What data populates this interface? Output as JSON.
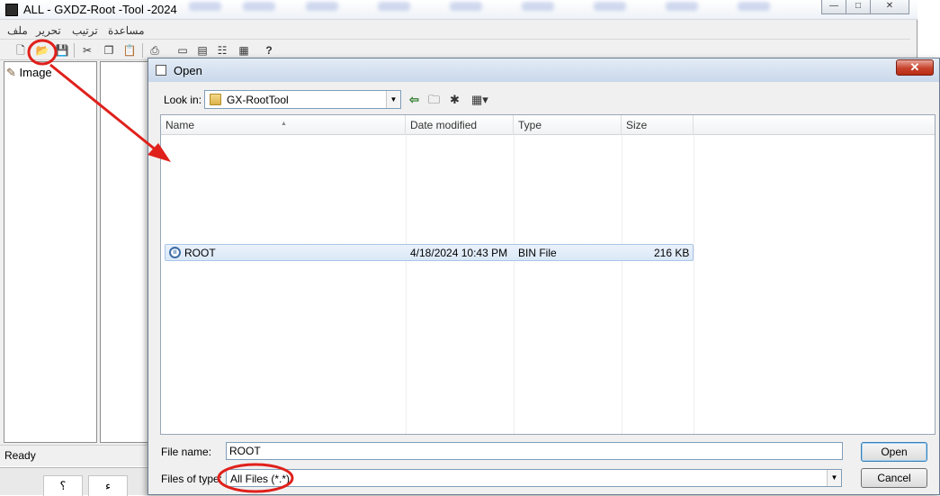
{
  "main_window": {
    "title": "ALL - GXDZ-Root -Tool -2024",
    "controls": {
      "minimize": "—",
      "maximize": "□",
      "close": "✕"
    },
    "menu": [
      "ملف",
      "تحرير",
      "ترتيب",
      "مساعدة"
    ],
    "tree_item": "Image",
    "status": "Ready"
  },
  "taskbar": {
    "keys": [
      "؟",
      "ء"
    ]
  },
  "dialog": {
    "title": "Open",
    "close_label": "✕",
    "look_in_label": "Look in:",
    "look_in_value": "GX-RootTool",
    "columns": [
      "Name",
      "Date modified",
      "Type",
      "Size"
    ],
    "files": [
      {
        "name": "ROOT",
        "date_modified": "4/18/2024 10:43 PM",
        "type": "BIN File",
        "size": "216 KB"
      }
    ],
    "file_name_label": "File name:",
    "file_name_value": "ROOT",
    "files_of_type_label": "Files of type:",
    "files_of_type_value": "All Files (*.*)",
    "open_button": "Open",
    "cancel_button": "Cancel"
  },
  "colors": {
    "annotation": "#e0201b",
    "selection": "#dae8f7",
    "close_button": "#c7422c"
  }
}
